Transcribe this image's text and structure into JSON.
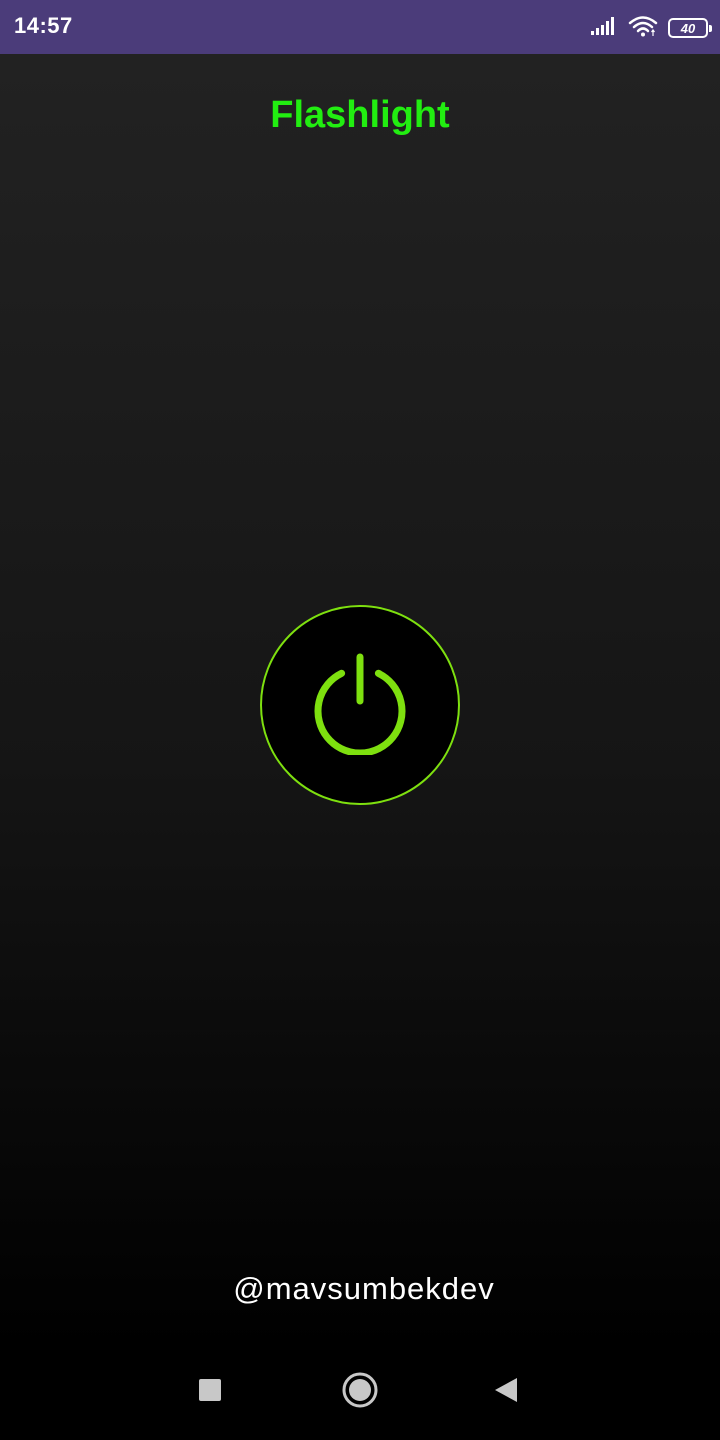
{
  "status_bar": {
    "time": "14:57",
    "battery_level": "40",
    "icons": [
      "signal-icon",
      "wifi-icon",
      "battery-icon"
    ],
    "background": "#4b3c7a"
  },
  "app": {
    "title": "Flashlight",
    "title_color": "#22ee11",
    "power_button": {
      "icon": "power-icon",
      "accent": "#7ee00f",
      "state": "off"
    },
    "credit": "@mavsumbekdev"
  },
  "nav_bar": {
    "buttons": [
      "recents-icon",
      "home-icon",
      "back-icon"
    ]
  }
}
